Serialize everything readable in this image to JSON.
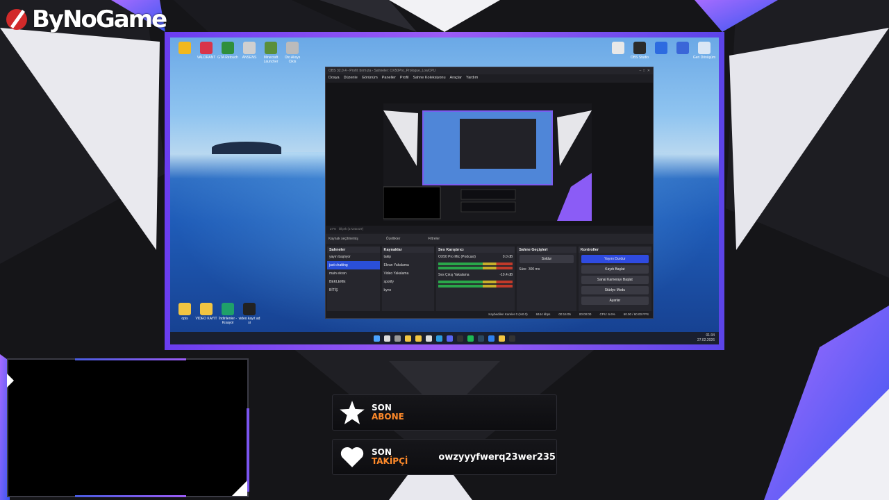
{
  "brand": {
    "name": "ByNoGame"
  },
  "colors": {
    "accent_purple": "#8b5cf6",
    "accent_orange": "#ff8a2a",
    "obs_primary": "#2f4be0"
  },
  "desktop": {
    "icons_top_left": [
      {
        "label": "",
        "icon": "app-icon",
        "color": "#f2b81e"
      },
      {
        "label": "VALORANT",
        "icon": "valorant-icon",
        "color": "#d8344a"
      },
      {
        "label": "GTA Retouch",
        "icon": "gta-icon",
        "color": "#2f8f3c"
      },
      {
        "label": "ANSENS",
        "icon": "knife-icon",
        "color": "#cfcfcf"
      },
      {
        "label": "Minecraft Launcher",
        "icon": "minecraft-icon",
        "color": "#5a8f3a"
      },
      {
        "label": "Oto Aksys Cikis",
        "icon": "tool-icon",
        "color": "#bbbbbb"
      }
    ],
    "icons_top_right": [
      {
        "label": "",
        "icon": "document-icon",
        "color": "#e8e8e8"
      },
      {
        "label": "OBS Studio",
        "icon": "obs-icon",
        "color": "#2b2b2b"
      },
      {
        "label": "",
        "icon": "blue-app-icon",
        "color": "#2d6be0"
      },
      {
        "label": "",
        "icon": "webcam-icon",
        "color": "#3a66d8"
      },
      {
        "label": "Geri Dönüşüm",
        "icon": "recycle-bin-icon",
        "color": "#d9e6f5"
      }
    ],
    "icons_bottom_left": [
      {
        "label": "opis",
        "icon": "folder-icon",
        "color": "#f2c542"
      },
      {
        "label": "VIDEO KAYIT",
        "icon": "folder-icon",
        "color": "#f2c542"
      },
      {
        "label": "İndirilenler - Kısayol",
        "icon": "download-folder-icon",
        "color": "#1fa06a"
      },
      {
        "label": "video kayıt ad si",
        "icon": "clapper-icon",
        "color": "#222222"
      }
    ],
    "taskbar": {
      "clock_time": "01:34",
      "clock_date": "27.02.2026",
      "icons": [
        "windows-icon",
        "search-icon",
        "taskview-icon",
        "chrome-icon",
        "explorer-icon",
        "store-icon",
        "edge-icon",
        "discord-icon",
        "obs-taskbar-icon",
        "spotify-icon",
        "steam-icon",
        "vscode-icon",
        "chrome-icon",
        "obs-taskbar-icon"
      ]
    }
  },
  "obs": {
    "title": "OBS 32.0.4 - Profil: bırmıza - Sahneler: OX50Pro_Prologue_LowCPU",
    "menu": [
      "Dosya",
      "Düzenle",
      "Görünüm",
      "Paneller",
      "Profil",
      "Sahne Koleksiyonu",
      "Araçlar",
      "Yardım"
    ],
    "zoom": "27%",
    "canvas_info": "Ölçek (1724x437)",
    "source_bar": {
      "none_selected": "Kaynak seçilmemiş",
      "properties": "Özellikler",
      "filters": "Filtreler"
    },
    "scenes": {
      "title": "Sahneler",
      "items": [
        "yayın başlıyor",
        "just chatting",
        "main ekran",
        "BEKLEME",
        "BİTİŞ"
      ],
      "selected": 1
    },
    "sources": {
      "title": "Kaynaklar",
      "items": [
        "takip",
        "Ekran Yakalama",
        "Video Yakalama",
        "spotify",
        "byno"
      ]
    },
    "mixer": {
      "title": "Ses Karıştırıcı",
      "tracks": [
        {
          "name": "OX50 Pro Mic (Podcast)",
          "db": "0.0 dB"
        },
        {
          "name": "Ses Çıkış Yakalama",
          "db": "-10.4 dB"
        }
      ]
    },
    "transitions": {
      "title": "Sahne Geçişleri",
      "type": "Soldur",
      "duration_label": "Süre",
      "duration": "300 ms"
    },
    "controls": {
      "title": "Kontroller",
      "buttons": [
        "Yayını Durdur",
        "Kaydı Başlat",
        "Sanal Kamerayı Başlat",
        "Stüdyo Modu",
        "Ayarlar"
      ]
    },
    "status": {
      "dropped": "Kaybedilen Kareler 0 (%0.0)",
      "bitrate": "8444 kbps",
      "live_time": "00:16:05",
      "rec_time": "00:00:00",
      "cpu": "CPU: 6.6%",
      "fps": "60.00 / 60.00 FPS"
    }
  },
  "alerts": {
    "sub": {
      "line1": "SON",
      "line2": "ABONE",
      "value": "",
      "icon": "star-icon"
    },
    "follow": {
      "line1": "SON",
      "line2": "TAKİPÇİ",
      "value": "owzyyyfwerq23wer235",
      "icon": "heart-icon"
    }
  }
}
